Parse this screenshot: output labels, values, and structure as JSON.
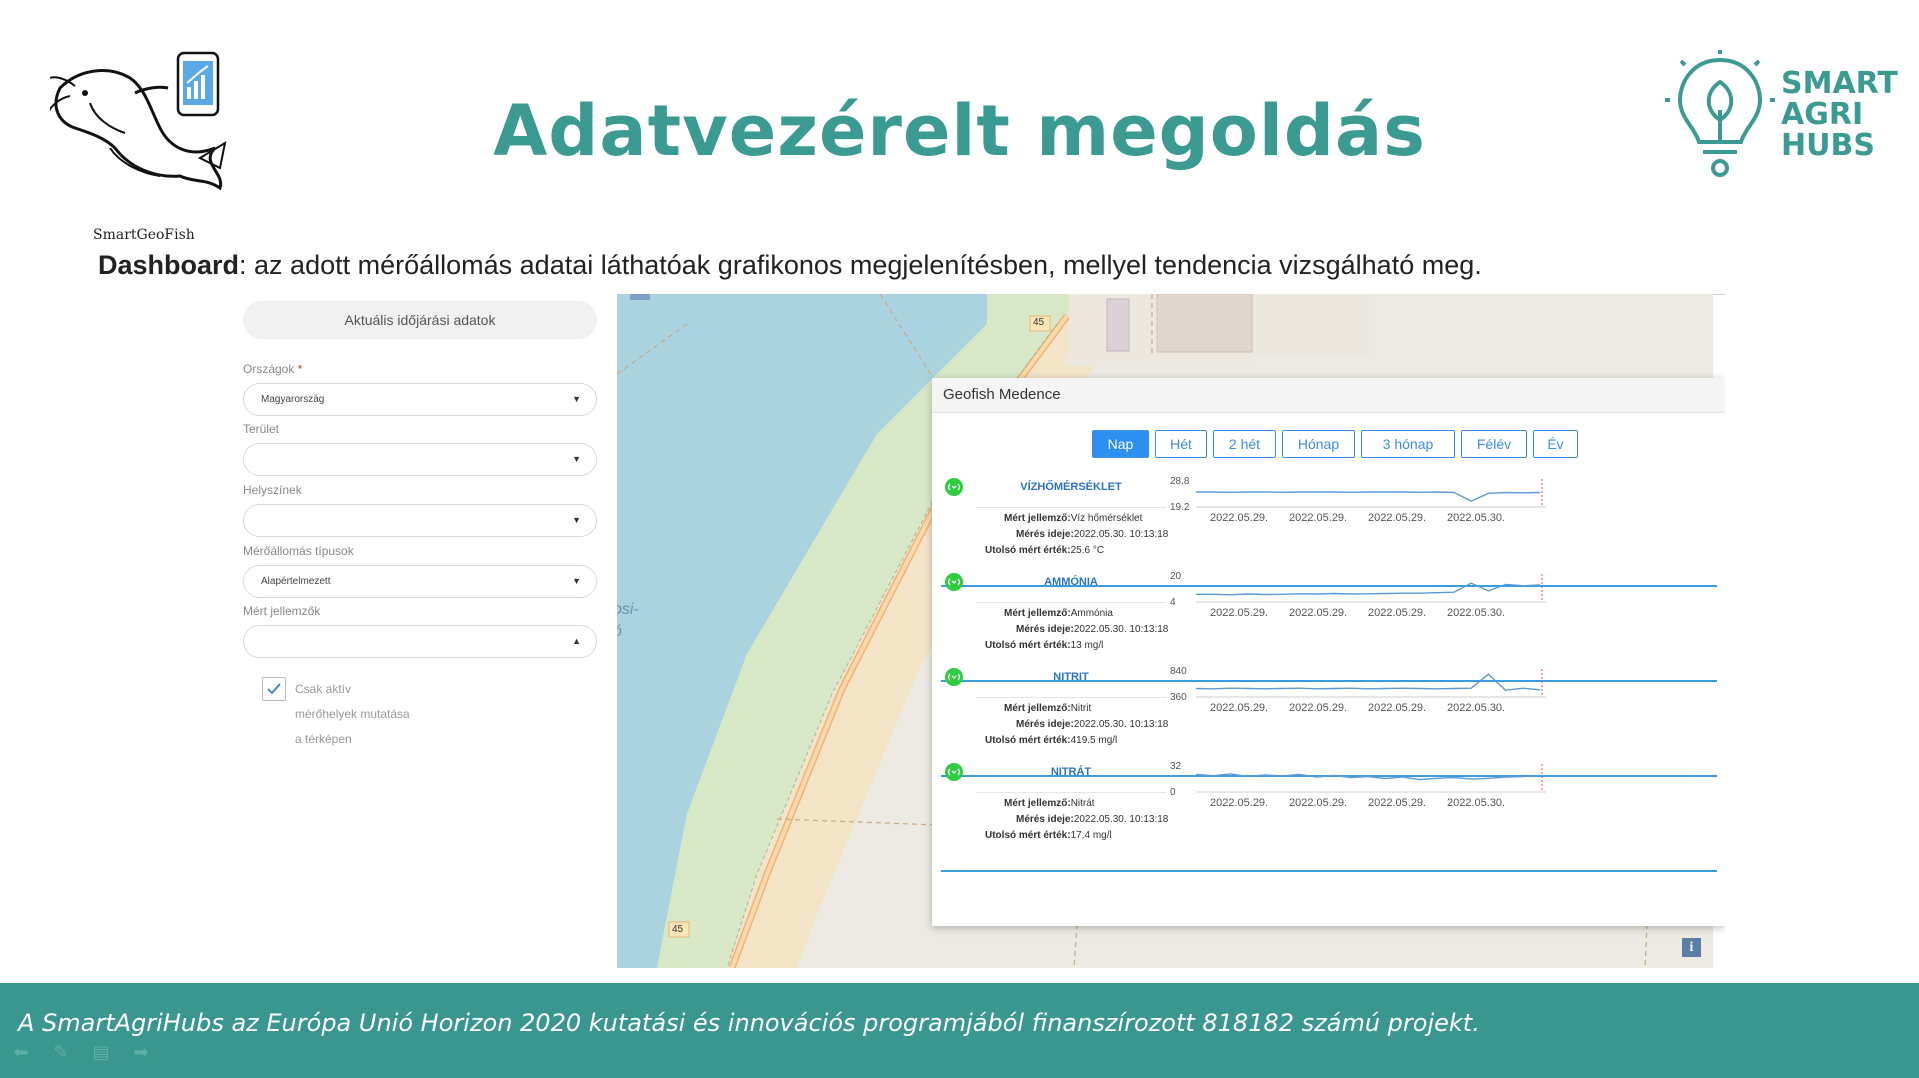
{
  "header": {
    "title": "Adatvezérelt megoldás",
    "fish_logo_caption": "SmartGeoFish",
    "sah_logo_lines": [
      "SMART",
      "AGRI",
      "HUBS"
    ],
    "subtitle_bold": "Dashboard",
    "subtitle_rest": ": az adott mérőállomás adatai láthatóak grafikonos megjelenítésben, mellyel tendencia vizsgálható meg."
  },
  "panel": {
    "weather_button": "Aktuális időjárási adatok",
    "countries_label": "Országok",
    "required_mark": "*",
    "countries_value": "Magyarország",
    "area_label": "Terület",
    "area_value": "",
    "locations_label": "Helyszínek",
    "locations_value": "",
    "station_types_label": "Mérőállomás típusok",
    "station_types_value": "Alapértelmezett",
    "measured_label": "Mért jellemzők",
    "measured_value": "",
    "active_only_checkbox_label": "Csak aktív mérőhelyek mutatása a térképen",
    "active_only_checked": true
  },
  "map": {
    "road_label_top": "45",
    "road_label_bottom": "45",
    "partial_place_label": "osi-\nó",
    "info_button": "i"
  },
  "popup": {
    "title": "Geofish Medence",
    "tabs": [
      "Nap",
      "Hét",
      "2 hét",
      "Hónap",
      "3 hónap",
      "Félév",
      "Év"
    ],
    "active_tab": "Nap",
    "field_labels": {
      "measured": "Mért jellemző:",
      "time": "Mérés ideje:",
      "last_value": "Utolsó mért érték:"
    },
    "metrics": [
      {
        "name": "VÍZHŐMÉRSÉKLET",
        "measured": "Víz hőmérséklet",
        "time": "2022.05.30. 10:13:18",
        "last_value": "25.6 °C",
        "y_max": "28.8",
        "y_min": "19.2",
        "x_ticks": [
          "2022.05.29.",
          "2022.05.29.",
          "2022.05.29.",
          "2022.05.30."
        ]
      },
      {
        "name": "AMMÓNIA",
        "measured": "Ammónia",
        "time": "2022.05.30. 10:13:18",
        "last_value": "13 mg/l",
        "y_max": "20",
        "y_min": "4",
        "x_ticks": [
          "2022.05.29.",
          "2022.05.29.",
          "2022.05.29.",
          "2022.05.30."
        ]
      },
      {
        "name": "NITRIT",
        "measured": "Nitrit",
        "time": "2022.05.30. 10:13:18",
        "last_value": "419.5 mg/l",
        "y_max": "840",
        "y_min": "360",
        "x_ticks": [
          "2022.05.29.",
          "2022.05.29.",
          "2022.05.29.",
          "2022.05.30."
        ]
      },
      {
        "name": "NITRÁT",
        "measured": "Nitrát",
        "time": "2022.05.30. 10:13:18",
        "last_value": "17.4 mg/l",
        "y_max": "32",
        "y_min": "0",
        "x_ticks": [
          "2022.05.29.",
          "2022.05.29.",
          "2022.05.29.",
          "2022.05.30."
        ]
      }
    ]
  },
  "footer": {
    "text": "A SmartAgriHubs az Európa Unió Horizon 2020 kutatási és innovációs programjából finanszírozott 818182 számú projekt."
  },
  "colors": {
    "title_teal": "#3b9b93",
    "footer_teal": "#3a9690",
    "tab_blue": "#2d8ff0",
    "metric_blue": "#2a74c8",
    "status_green": "#2ecc40",
    "river_blue": "#aad3df"
  },
  "icons": [
    "catfish-logo",
    "phone-chart-icon",
    "lightbulb-leaf-logo",
    "chevron-down-icon",
    "checkmark-icon",
    "signal-status-icon",
    "info-icon",
    "nav-back-icon",
    "pen-icon",
    "menu-icon",
    "nav-forward-icon"
  ]
}
